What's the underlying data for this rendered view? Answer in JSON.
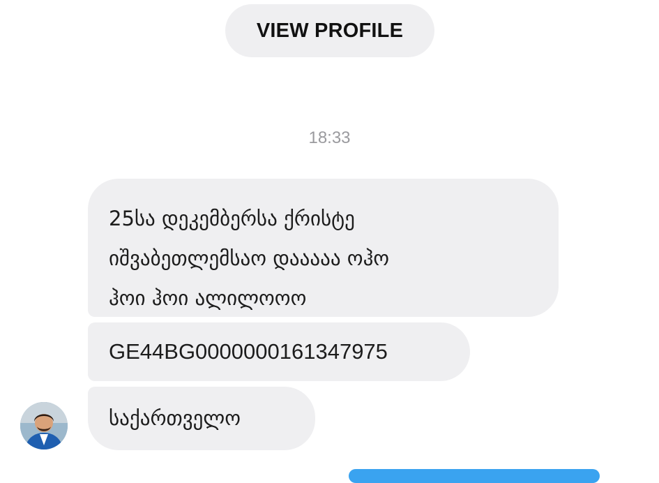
{
  "header": {
    "view_profile_label": "VIEW PROFILE"
  },
  "conversation": {
    "timestamp": "18:33",
    "messages": [
      {
        "lines": [
          "25სა დეკემბერსა ქრისტე",
          "იშვაბეთლემსაო დააააა ოჰო",
          "ჰოი ჰოი ალილოოო"
        ]
      },
      {
        "text": "GE44BG0000000161347975"
      },
      {
        "text": "საქართველო"
      }
    ]
  },
  "colors": {
    "bubble_gray": "#efeff1",
    "timestamp_gray": "#9a9a9e",
    "outgoing_blue": "#3aa3f0"
  }
}
